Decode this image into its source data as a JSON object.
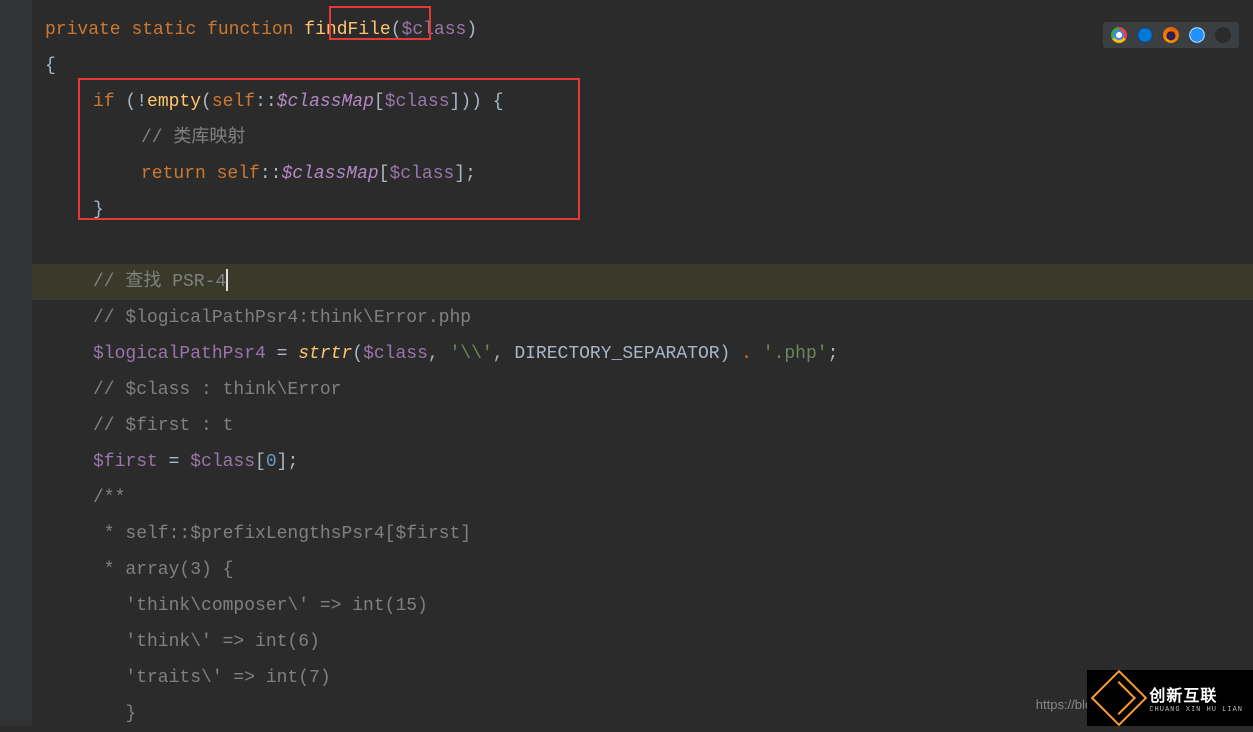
{
  "code": {
    "l1_private": "private",
    "l1_static": "static",
    "l1_function": "function",
    "l1_findFile": "findFile",
    "l1_open": "(",
    "l1_class": "$class",
    "l1_close": ")",
    "l2_brace": "{",
    "l3_if": "if",
    "l3_open": " (!",
    "l3_empty": "empty",
    "l3_open2": "(",
    "l3_self": "self",
    "l3_scope": "::",
    "l3_classMap": "$classMap",
    "l3_br1": "[",
    "l3_class": "$class",
    "l3_br2": "]",
    "l3_close": ")) {",
    "l4_comment": "// 类库映射",
    "l5_return": "return",
    "l5_self": "self",
    "l5_scope": "::",
    "l5_classMap": "$classMap",
    "l5_br1": "[",
    "l5_class": "$class",
    "l5_br2": "];",
    "l6_brace": "}",
    "l8_comment": "// 查找 PSR-4",
    "l9_comment": "// $logicalPathPsr4:think\\Error.php",
    "l10_var": "$logicalPathPsr4",
    "l10_eq": " = ",
    "l10_fn": "strtr",
    "l10_open": "(",
    "l10_class": "$class",
    "l10_comma": ", ",
    "l10_s1": "'\\\\'",
    "l10_comma2": ", ",
    "l10_const": "DIRECTORY_SEPARATOR",
    "l10_close": ") ",
    "l10_dot": ".",
    "l10_s2": " '.php'",
    "l10_semi": ";",
    "l11_comment": "// $class : think\\Error",
    "l12_comment": "// $first : t",
    "l13_first": "$first",
    "l13_eq": " = ",
    "l13_class": "$class",
    "l13_br1": "[",
    "l13_num": "0",
    "l13_br2": "];",
    "l14_c": "/**",
    "l15_c": " * self::$prefixLengthsPsr4[$first]",
    "l16_c": " * array(3) {",
    "l17_c": "   'think\\composer\\' => int(15)",
    "l18_c": "   'think\\' => int(6)",
    "l19_c": "   'traits\\' => int(7)",
    "l20_c": "   }"
  },
  "ui": {
    "url_stub": "https://blog.",
    "brand_cn": "创新互联",
    "brand_en": "CHUANG XIN HU LIAN"
  }
}
